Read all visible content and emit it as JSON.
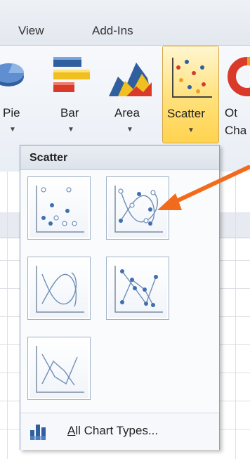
{
  "tabs": {
    "view": "View",
    "addins": "Add-Ins"
  },
  "ribbon": {
    "pie": "Pie",
    "bar": "Bar",
    "area": "Area",
    "scatter": "Scatter",
    "other_line1": "Ot",
    "other_line2": "Cha",
    "dropdown_arrow": "▼"
  },
  "dropdown": {
    "title": "Scatter",
    "footer_first_letter": "A",
    "footer_rest": "ll Chart Types..."
  },
  "colors": {
    "accent_arrow": "#f26b1d",
    "marker": "#3f6fb0",
    "scatter_highlight": "#ffd34f"
  }
}
